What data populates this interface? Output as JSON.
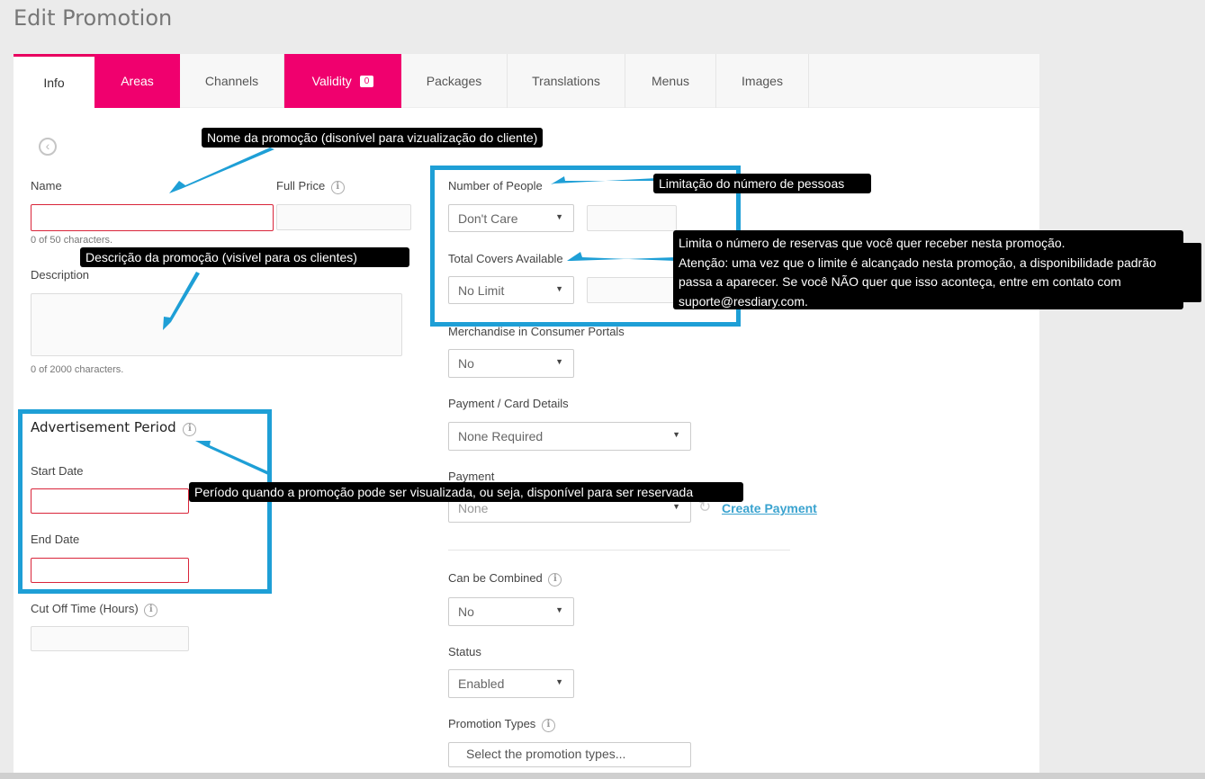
{
  "page": {
    "title": "Edit Promotion"
  },
  "tabs": [
    {
      "label": "Info"
    },
    {
      "label": "Areas"
    },
    {
      "label": "Channels"
    },
    {
      "label": "Validity",
      "badge": "0"
    },
    {
      "label": "Packages"
    },
    {
      "label": "Translations"
    },
    {
      "label": "Menus"
    },
    {
      "label": "Images"
    }
  ],
  "form": {
    "name_label": "Name",
    "name_hint": "0 of 50 characters.",
    "full_price_label": "Full Price",
    "description_label": "Description",
    "description_hint": "0 of 2000 characters.",
    "advert_title": "Advertisement Period",
    "start_date_label": "Start Date",
    "end_date_label": "End Date",
    "cutoff_label": "Cut Off Time (Hours)",
    "num_people_label": "Number of People",
    "num_people_value": "Don't Care",
    "total_covers_label": "Total Covers Available",
    "total_covers_value": "No Limit",
    "merch_label": "Merchandise in Consumer Portals",
    "merch_value": "No",
    "payment_card_label": "Payment / Card Details",
    "payment_card_value": "None Required",
    "payment_label": "Payment",
    "payment_value": "None",
    "create_payment": "Create Payment",
    "combined_label": "Can be Combined",
    "combined_value": "No",
    "status_label": "Status",
    "status_value": "Enabled",
    "types_label": "Promotion Types",
    "types_placeholder": "Select the promotion types..."
  },
  "annotations": {
    "name": "Nome da promoção (disonível para vizualização do cliente)",
    "description": "Descrição da promoção (visível para os clientes)",
    "people": "Limitação do número de pessoas",
    "covers_1": "Limita o número de reservas que você quer receber nesta promoção.",
    "covers_2": "Atenção: uma vez que o limite é alcançado nesta promoção, a disponibilidade padrão passa a aparecer. Se você NÃO quer que isso aconteça, entre em contato com suporte@resdiary.com.",
    "period": "Período quando a promoção pode ser visualizada, ou seja, disponível para ser reservada"
  },
  "colors": {
    "accent": "#f0006e",
    "highlight": "#1e9fd6",
    "error": "#d9253a",
    "link": "#3aa3cf"
  },
  "icons": {
    "back": "chevron-left-circle-icon",
    "info": "info-circle-icon",
    "refresh": "refresh-icon",
    "dropdown": "caret-down-icon"
  }
}
